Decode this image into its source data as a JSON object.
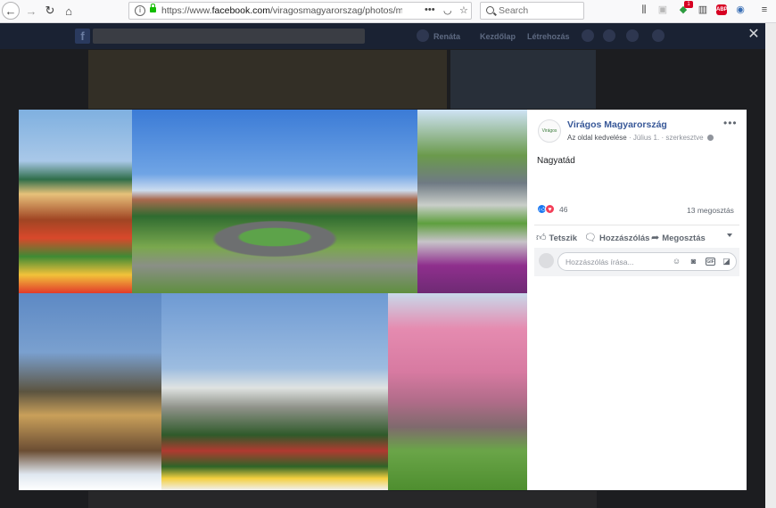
{
  "browser": {
    "url_prefix": "https://www.",
    "url_domain": "facebook.com",
    "url_path": "/viragosmagyarorszag/photos/ms.c.e",
    "search_placeholder": "Search",
    "more_glyph": "•••",
    "badge_red": "1",
    "badge_abp": "ABP",
    "badge_abp_count": "6"
  },
  "facebook": {
    "logo": "f",
    "nav": [
      "Renáta",
      "Kezdőlap",
      "Létrehozás"
    ]
  },
  "viewer": {
    "close_glyph": "✕"
  },
  "post": {
    "page_name": "Virágos Magyarország",
    "avatar_text": "Virágos Magyarország",
    "meta_like": "Az oldal kedvelése",
    "meta_date": "Július 1.",
    "meta_edited": "szerkesztve",
    "more_glyph": "•••",
    "text": "Nagyatád",
    "reactions_count": "46",
    "shares": "13 megosztás",
    "actions": {
      "like": "Tetszik",
      "comment": "Hozzászólás",
      "share": "Megosztás"
    },
    "comment_placeholder": "Hozzászólás írása..."
  },
  "colors": {
    "fb_blue": "#385898",
    "like_blue": "#1877f2",
    "love_red": "#f33e58",
    "overlay_dark": "#1c1d20"
  }
}
